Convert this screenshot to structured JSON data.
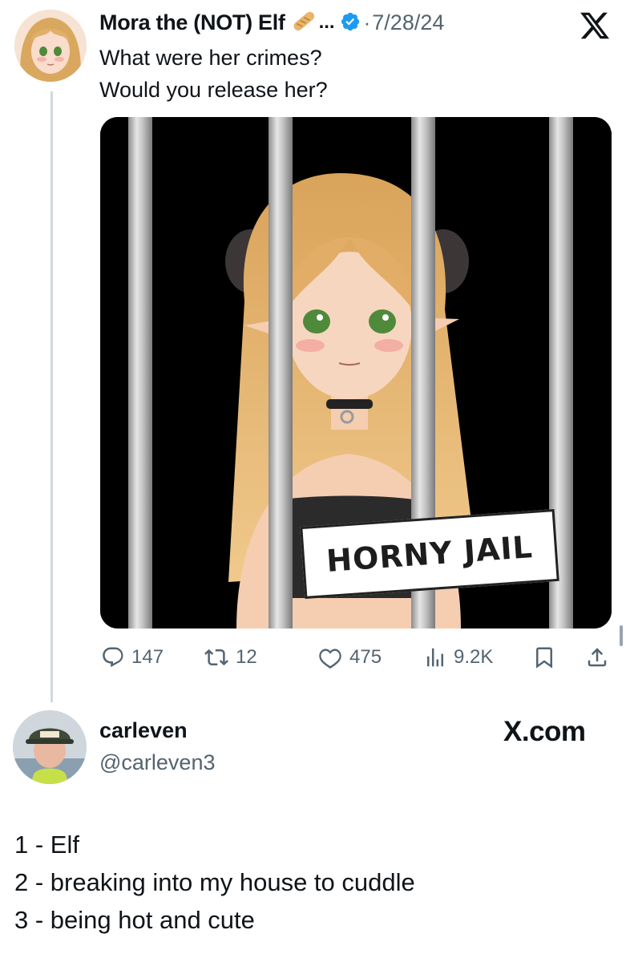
{
  "tweet": {
    "author_name": "Mora the (NOT) Elf",
    "author_emoji": "bread-icon",
    "ellipsis": "...",
    "verified": true,
    "separator": "·",
    "date": "7/28/24",
    "text_lines": [
      "What were her crimes?",
      "Would you release her?"
    ],
    "media": {
      "sign_text": "HORNY JAIL",
      "description_icon": "anime-elf-in-jail-image"
    },
    "stats": {
      "replies": "147",
      "reposts": "12",
      "likes": "475",
      "views": "9.2K"
    }
  },
  "reply_author": {
    "name": "carleven",
    "handle": "@carleven3",
    "brand": "X.com"
  },
  "reply_lines": [
    "1 - Elf",
    "2 - breaking into my house to cuddle",
    "3 - being hot and cute"
  ],
  "colors": {
    "text": "#0f1419",
    "muted": "#536471",
    "verified": "#1d9bf0",
    "thread_line": "#cfd9de"
  }
}
